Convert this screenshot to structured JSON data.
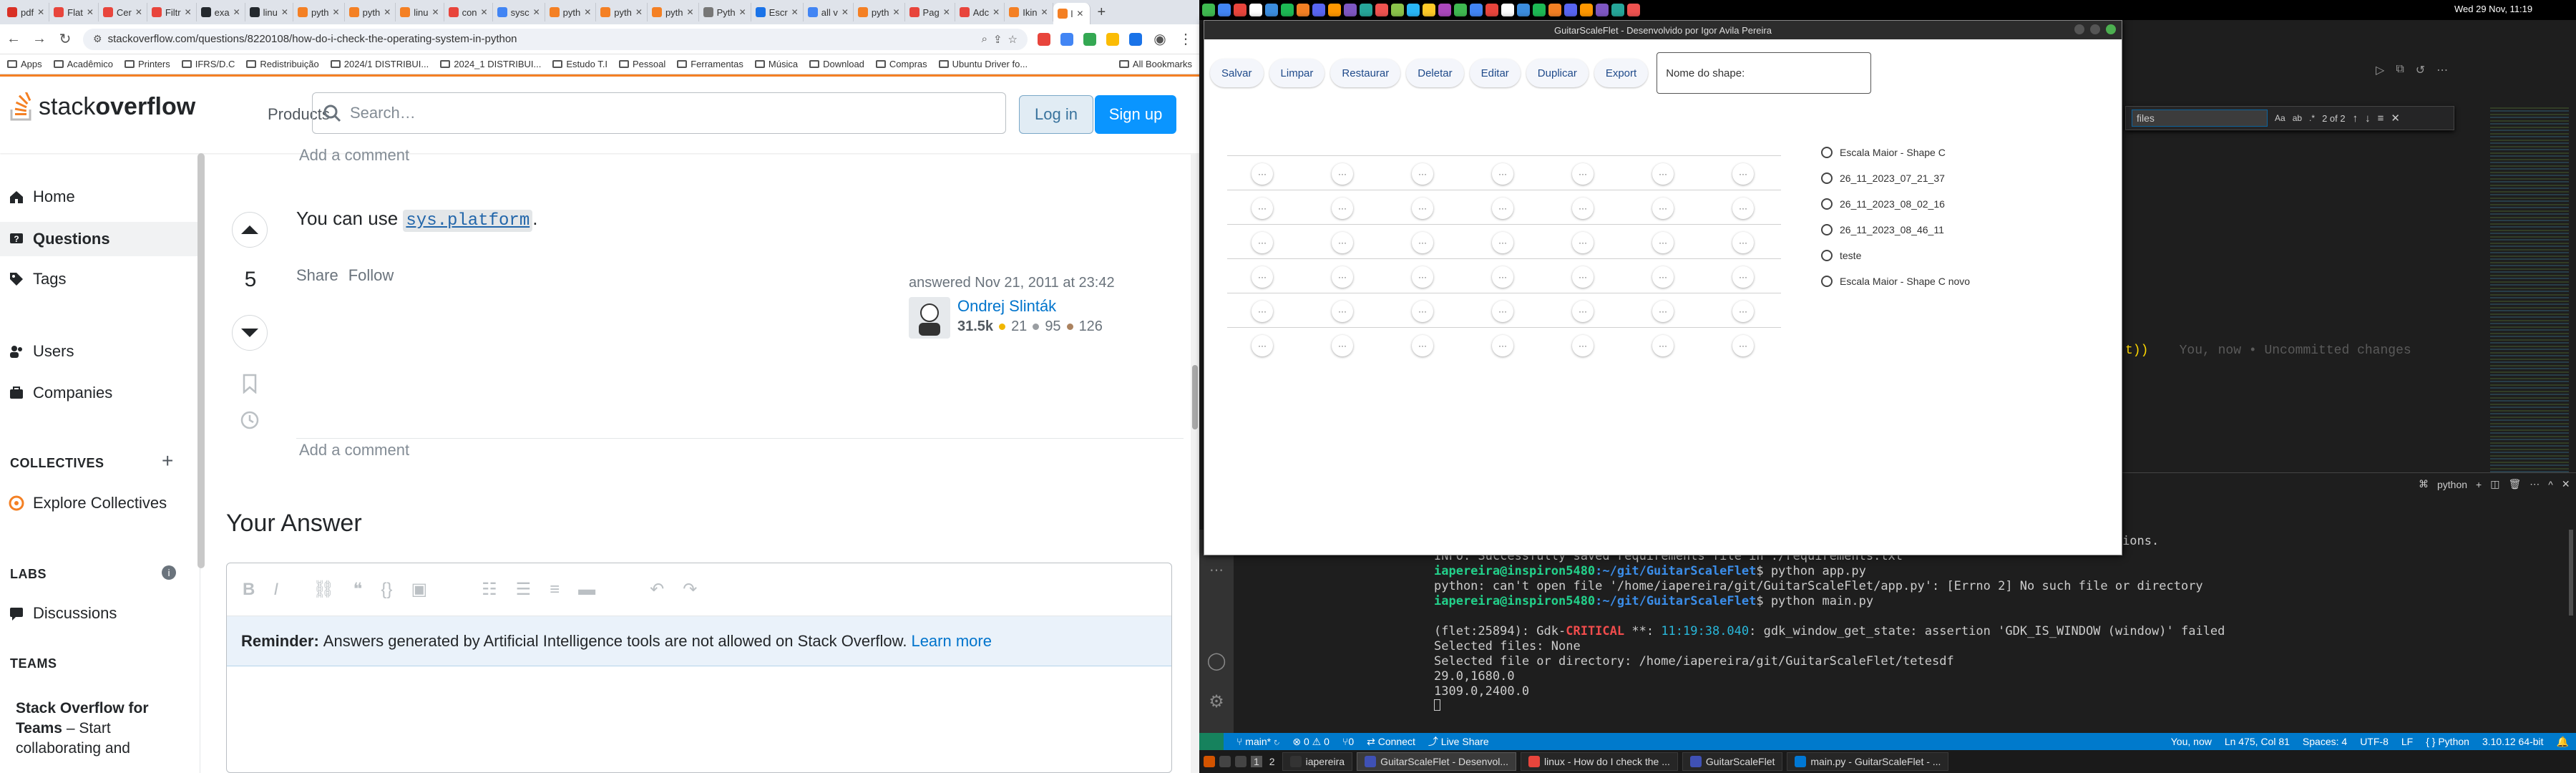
{
  "browser": {
    "tabs": [
      {
        "label": "pdf",
        "color": "#d93025"
      },
      {
        "label": "Flat",
        "color": "#e8453c"
      },
      {
        "label": "Cer",
        "color": "#e8453c"
      },
      {
        "label": "Filtr",
        "color": "#e8453c"
      },
      {
        "label": "exa",
        "color": "#24292e"
      },
      {
        "label": "linu",
        "color": "#24292e"
      },
      {
        "label": "pyth",
        "color": "#f48024"
      },
      {
        "label": "pyth",
        "color": "#f48024"
      },
      {
        "label": "linu",
        "color": "#f48024"
      },
      {
        "label": "con",
        "color": "#e8453c"
      },
      {
        "label": "sysc",
        "color": "#4285f4"
      },
      {
        "label": "pyth",
        "color": "#f48024"
      },
      {
        "label": "pyth",
        "color": "#f48024"
      },
      {
        "label": "pyth",
        "color": "#f48024"
      },
      {
        "label": "Pyth",
        "color": "#777777"
      },
      {
        "label": "Escr",
        "color": "#1a73e8"
      },
      {
        "label": "all v",
        "color": "#4285f4"
      },
      {
        "label": "pyth",
        "color": "#f48024"
      },
      {
        "label": "Pag",
        "color": "#e8453c"
      },
      {
        "label": "Adc",
        "color": "#e8453c"
      },
      {
        "label": "Ikin",
        "color": "#f48024"
      },
      {
        "label": "l",
        "color": "#f48024",
        "active": true
      }
    ],
    "new_tab": "+",
    "url": "stackoverflow.com/questions/8220108/how-do-i-check-the-operating-system-in-python",
    "bookmarks": [
      "Apps",
      "Acadêmico",
      "Printers",
      "IFRS/D.C",
      "Redistribuição",
      "2024/1 DISTRIBUI...",
      "2024_1 DISTRIBUI...",
      "Estudo T.I",
      "Pessoal",
      "Ferramentas",
      "Música",
      "Download",
      "Compras",
      "Ubuntu Driver fo..."
    ],
    "all_bookmarks": "All Bookmarks"
  },
  "so": {
    "logo_plain": "stack",
    "logo_bold": "overflow",
    "products": "Products",
    "search_placeholder": "Search…",
    "login": "Log in",
    "signup": "Sign up",
    "nav": {
      "home": "Home",
      "questions": "Questions",
      "tags": "Tags",
      "users": "Users",
      "companies": "Companies",
      "collectives_head": "COLLECTIVES",
      "explore_collectives": "Explore Collectives",
      "labs_head": "LABS",
      "discussions": "Discussions",
      "teams_head": "TEAMS",
      "teams_promo_bold": "Stack Overflow for Teams",
      "teams_promo_rest": " – Start collaborating and"
    },
    "add_comment_top": "Add a comment",
    "answer": {
      "text_before": "You can use ",
      "code": "sys.platform",
      "text_after": ".",
      "votes": "5",
      "share": "Share",
      "follow": "Follow",
      "answered": "answered Nov 21, 2011 at 23:42",
      "user": "Ondrej Slinták",
      "rep": "31.5k",
      "gold": "21",
      "silver": "95",
      "bronze": "126"
    },
    "add_comment_bottom": "Add a comment",
    "your_answer": "Your Answer",
    "reminder_bold": "Reminder:",
    "reminder_text": "Answers generated by Artificial Intelligence tools are not allowed on Stack Overflow.",
    "reminder_link": "Learn more"
  },
  "flet": {
    "title": "GuitarScaleFlet - Desenvolvido por Igor Avila Pereira",
    "buttons": [
      "Salvar",
      "Limpar",
      "Restaurar",
      "Deletar",
      "Editar",
      "Duplicar",
      "Export"
    ],
    "shape_name_label": "Nome do shape:",
    "grid_cell": "···",
    "grid_rows": 6,
    "grid_cols": 7,
    "shapes": [
      "Escala Maior - Shape C",
      "26_11_2023_07_21_37",
      "26_11_2023_08_02_16",
      "26_11_2023_08_46_11",
      "teste",
      "Escala Maior - Shape C novo"
    ]
  },
  "vscode": {
    "find_value": "files",
    "find_count": "2 of 2",
    "ghost_paren": "t))",
    "ghost_text": "You, now • Uncommitted changes",
    "panel_shell": "python",
    "terminal_lines": [
      {
        "text": "Please, verify manually the final list of requirements.txt to avoid possible dependency collisions."
      },
      {
        "text": "INFO: Successfully saved requirements file in ./requirements.txt"
      },
      {
        "prompt": "iapereira@inspiron5480",
        "path": ":~/git/GuitarScaleFlet",
        "cmd": "$ python app.py"
      },
      {
        "text": "python: can't open file '/home/iapereira/git/GuitarScaleFlet/app.py': [Errno 2] No such file or directory"
      },
      {
        "prompt": "iapereira@inspiron5480",
        "path": ":~/git/GuitarScaleFlet",
        "cmd": "$ python main.py"
      },
      {
        "text": ""
      },
      {
        "gdk": "(flet:25894): Gdk-",
        "crit": "CRITICAL",
        "rest": " **: ",
        "time": "11:19:38.040",
        "tail": ": gdk_window_get_state: assertion 'GDK_IS_WINDOW (window)' failed"
      },
      {
        "text": "Selected files: None"
      },
      {
        "text": "Selected file or directory: /home/iapereira/git/GuitarScaleFlet/tetesdf"
      },
      {
        "text": "29.0,1680.0"
      },
      {
        "text": "1309.0,2400.0"
      }
    ],
    "status": {
      "branch": "main*",
      "errors": "⊗ 0 ⚠ 0",
      "ports": "⑂0",
      "connect": "Connect",
      "live_share": "Live Share",
      "blame": "You, now",
      "position": "Ln 475, Col 81",
      "spaces": "Spaces: 4",
      "encoding": "UTF-8",
      "eol": "LF",
      "language": "Python",
      "version": "3.10.12 64-bit"
    }
  },
  "system": {
    "clock": "Wed 29 Nov, 11:19",
    "taskbar": [
      "iapereira",
      "GuitarScaleFlet - Desenvol...",
      "linux - How do I check the ...",
      "GuitarScaleFlet",
      "main.py - GuitarScaleFlet - ..."
    ],
    "workspaces": [
      "1",
      "2"
    ]
  }
}
